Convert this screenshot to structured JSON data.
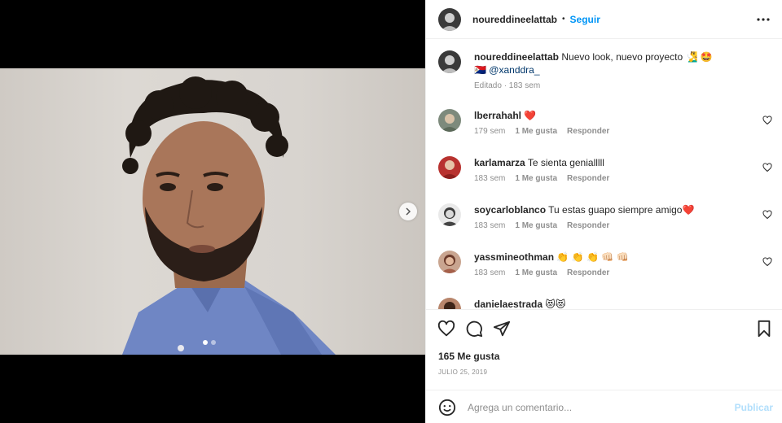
{
  "author": {
    "username": "noureddineelattab",
    "follow_label": "Seguir",
    "separator": "•"
  },
  "caption": {
    "username": "noureddineelattab",
    "text": "Nuevo look, nuevo proyecto 🧏‍♂️ 🤩",
    "flag": "🇸🇽",
    "mention": "@xanddra_",
    "meta": "Editado · 183 sem"
  },
  "comments": [
    {
      "username": "lberrahahl",
      "text": "❤️",
      "time": "179 sem",
      "likes": "1 Me gusta",
      "reply": "Responder"
    },
    {
      "username": "karlamarza",
      "text": "Te sienta genialllll",
      "time": "183 sem",
      "likes": "1 Me gusta",
      "reply": "Responder"
    },
    {
      "username": "soycarloblanco",
      "text": "Tu estas guapo siempre amigo❤️",
      "time": "183 sem",
      "likes": "1 Me gusta",
      "reply": "Responder"
    },
    {
      "username": "yassmineothman",
      "text": "👏 👏 👏 👊🏻 👊🏻",
      "time": "183 sem",
      "likes": "1 Me gusta",
      "reply": "Responder"
    },
    {
      "username": "danielaestrada",
      "text": "😻😻"
    }
  ],
  "likes_text": "165 Me gusta",
  "date": "JULIO 25, 2019",
  "add_comment": {
    "placeholder": "Agrega un comentario...",
    "publish_label": "Publicar"
  },
  "carousel": {
    "current": 1,
    "total": 2
  },
  "colors": {
    "accent": "#0095f6",
    "publish_disabled": "#b2dffc",
    "muted": "#8e8e8e"
  },
  "icons": [
    "more-options-icon",
    "heart-icon",
    "comment-icon",
    "share-icon",
    "bookmark-icon",
    "emoji-icon",
    "chevron-right-icon"
  ]
}
